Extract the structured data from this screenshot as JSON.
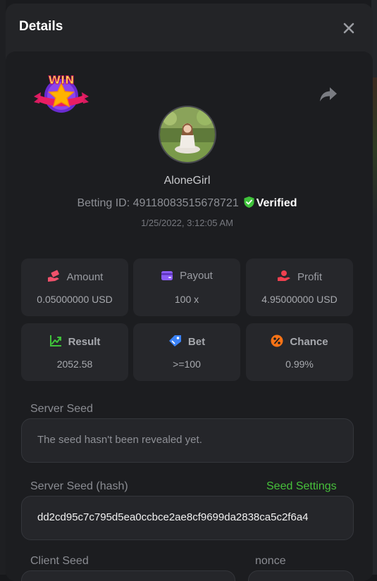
{
  "modal": {
    "title": "Details"
  },
  "bet": {
    "username": "AloneGirl",
    "betting_id_label": "Betting ID:",
    "betting_id": "49118083515678721",
    "verified_label": "Verified",
    "timestamp": "1/25/2022, 3:12:05 AM"
  },
  "badge": {
    "text": "WIN"
  },
  "stats": [
    {
      "label": "Amount",
      "value": "0.05000000 USD",
      "icon": "money-hand-icon",
      "color": "#f0516b"
    },
    {
      "label": "Payout",
      "value": "100 x",
      "icon": "wallet-icon",
      "color": "#8b5cf6"
    },
    {
      "label": "Profit",
      "value": "4.95000000 USD",
      "icon": "profit-hand-icon",
      "color": "#f0404f"
    },
    {
      "label": "Result",
      "value": "2052.58",
      "icon": "chart-up-icon",
      "color": "#3fc23a"
    },
    {
      "label": "Bet",
      "value": ">=100",
      "icon": "ticket-icon",
      "color": "#3b82f6"
    },
    {
      "label": "Chance",
      "value": "0.99%",
      "icon": "percent-icon",
      "color": "#f97316"
    }
  ],
  "server_seed": {
    "label": "Server Seed",
    "value": "The seed hasn't been revealed yet."
  },
  "server_seed_hash": {
    "label": "Server Seed (hash)",
    "value": "dd2cd95c7c795d5ea0ccbce2ae8cf9699da2838ca5c2f6a4",
    "link": "Seed Settings"
  },
  "client_seed": {
    "label": "Client Seed"
  },
  "nonce": {
    "label": "nonce"
  },
  "colors": {
    "accent_green": "#47c03b",
    "verified_green": "#3fc23a",
    "panel_bg": "#1c1d20",
    "card_bg": "#26272b"
  }
}
